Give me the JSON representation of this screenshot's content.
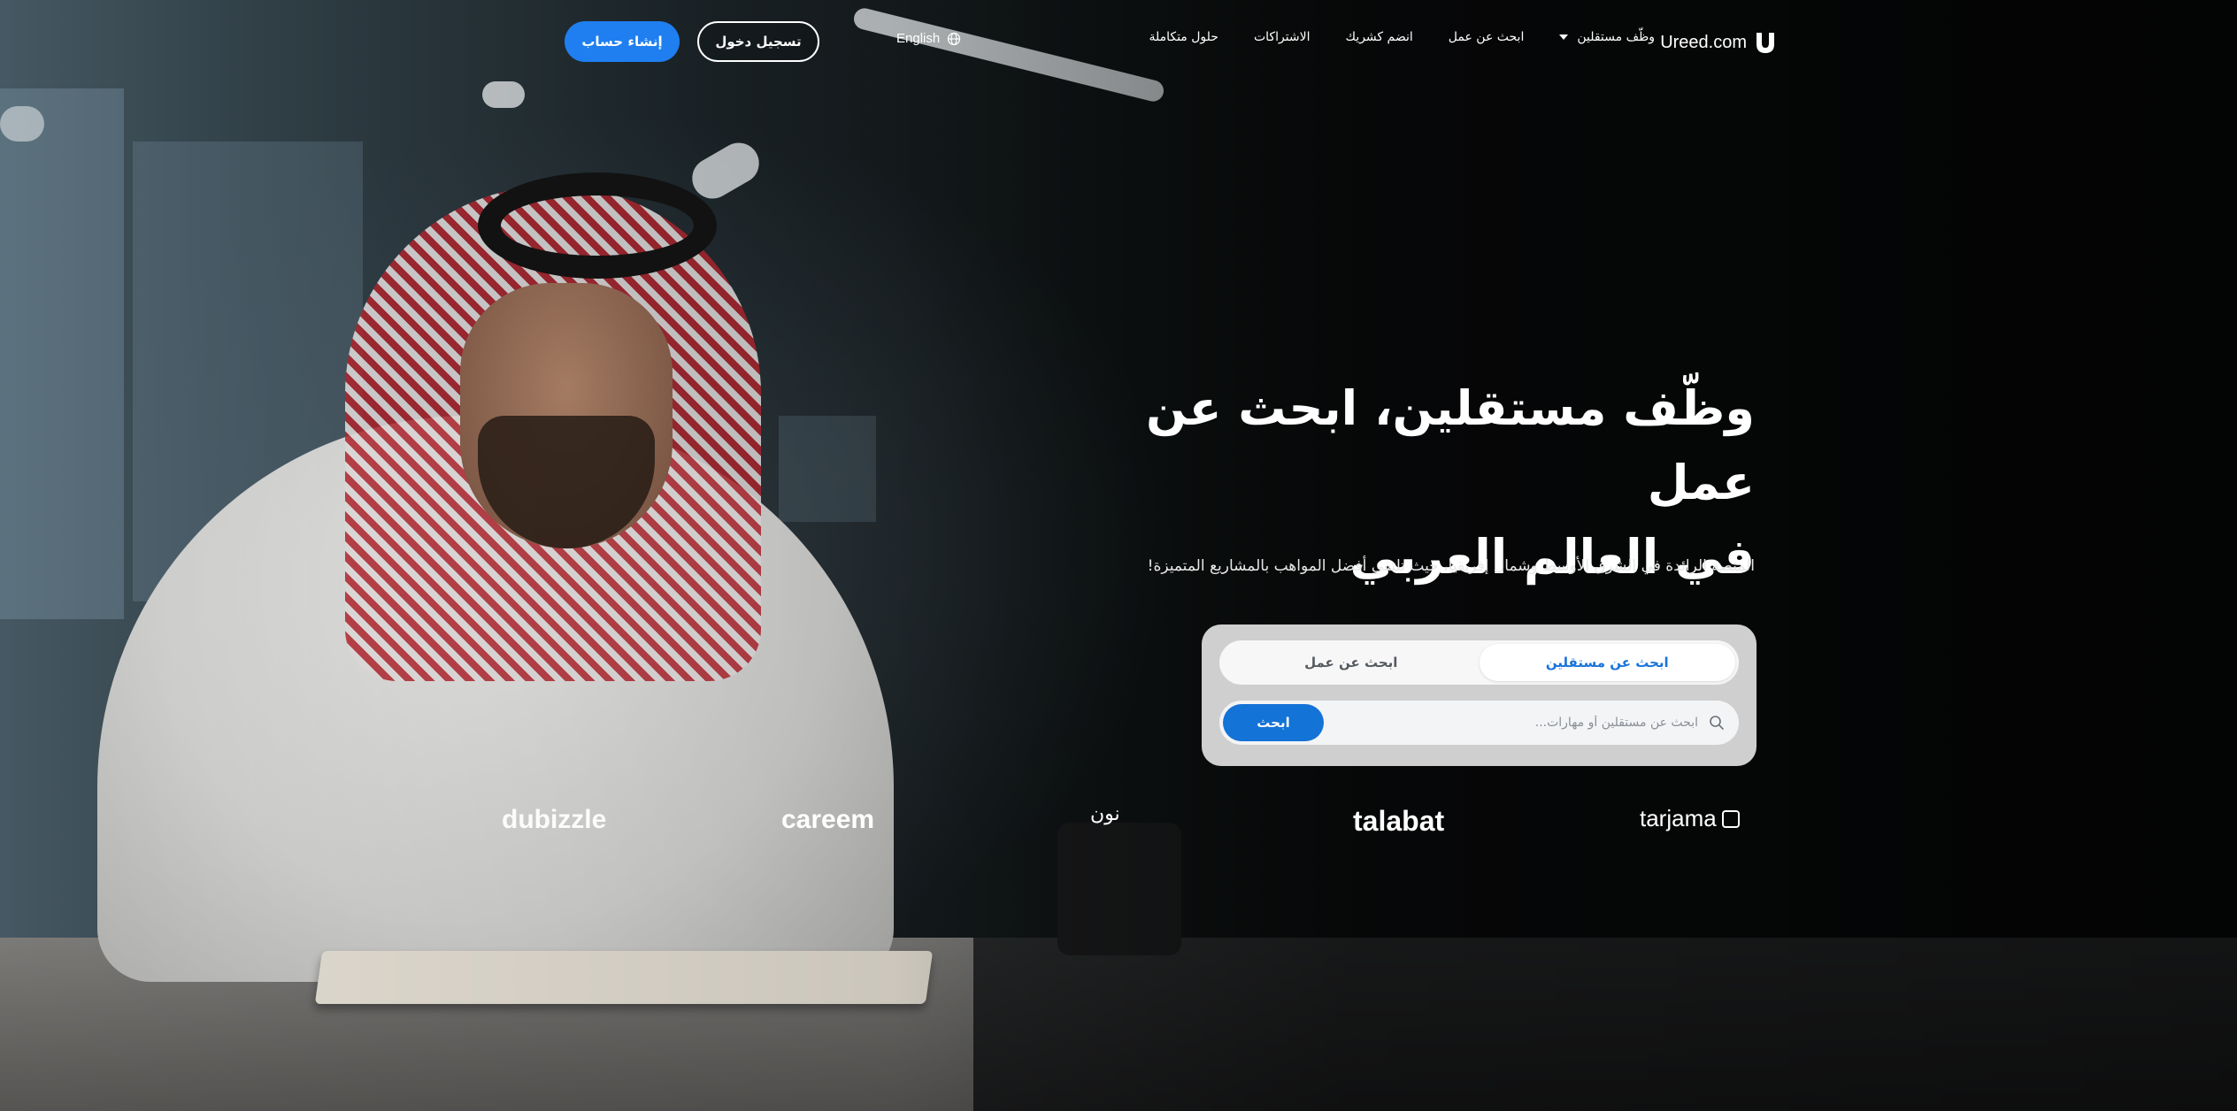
{
  "nav": {
    "brand": "Ureed.com",
    "links": [
      {
        "label": "وظّف مستقلين",
        "has_dropdown": true
      },
      {
        "label": "ابحث عن عمل"
      },
      {
        "label": "انضم كشريك"
      },
      {
        "label": "الاشتراكات"
      },
      {
        "label": "حلول متكاملة"
      }
    ],
    "language": "English",
    "login_label": "تسجيل دخول",
    "signup_label": "إنشاء حساب"
  },
  "hero": {
    "title_bold_1": "وظّف",
    "title_regular_1": " مستقلين، ",
    "title_bold_2": "ابحث",
    "title_regular_2": " عن عمل",
    "title_line_2": "في العالم العربي",
    "subtitle": "المنصة الرائدة في الشرق الأوسط وشمال إفريقيا، حيث تلتقي أفضل المواهب بالمشاريع المتميزة!"
  },
  "search": {
    "tabs": [
      {
        "label": "ابحث عن مستقلين",
        "active": true
      },
      {
        "label": "ابحث عن عمل",
        "active": false
      }
    ],
    "placeholder": "ابحث عن مستقلين أو مهارات...",
    "value": "",
    "button_label": "ابحث"
  },
  "clients": {
    "dubizzle": "dubizzle",
    "careem": "careem",
    "noon": "نون",
    "talabat": "talabat",
    "tarjama": "tarjama"
  },
  "colors": {
    "primary_blue": "#1f7ff0",
    "search_blue": "#1373d6",
    "tab_active_text": "#1a73d9"
  },
  "icons": {
    "logo": "ureed-logo-icon",
    "language": "globe-icon",
    "dropdown": "caret-down-icon",
    "search": "search-icon"
  }
}
